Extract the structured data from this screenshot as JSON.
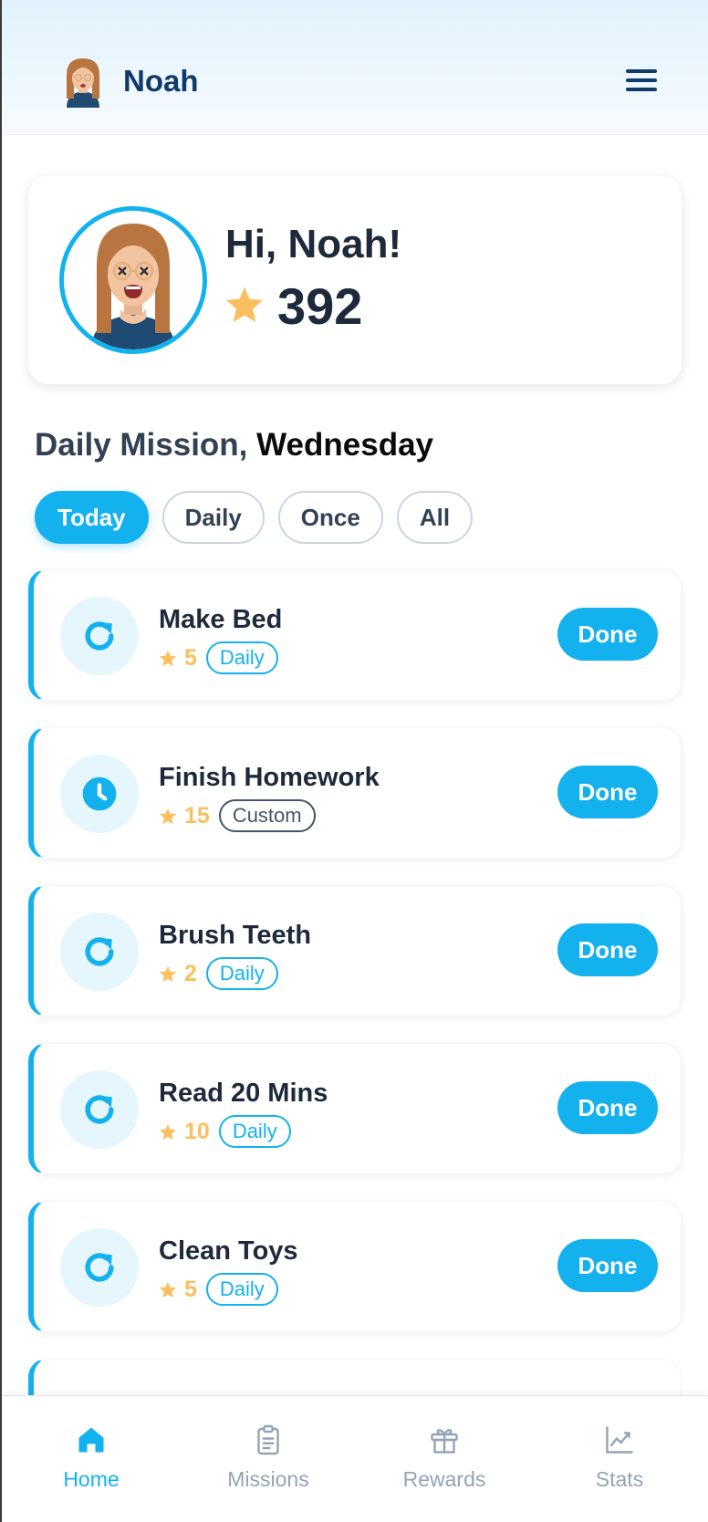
{
  "header": {
    "user_name": "Noah"
  },
  "profile": {
    "greeting": "Hi, Noah!",
    "points": "392"
  },
  "section": {
    "title_prefix": "Daily Mission,",
    "title_day": "Wednesday"
  },
  "filters": [
    {
      "label": "Today",
      "active": true
    },
    {
      "label": "Daily",
      "active": false
    },
    {
      "label": "Once",
      "active": false
    },
    {
      "label": "All",
      "active": false
    }
  ],
  "tasks": [
    {
      "title": "Make Bed",
      "points": "5",
      "tag": "Daily",
      "icon": "repeat-icon",
      "action": "Done"
    },
    {
      "title": "Finish Homework",
      "points": "15",
      "tag": "Custom",
      "icon": "clock-icon",
      "action": "Done"
    },
    {
      "title": "Brush Teeth",
      "points": "2",
      "tag": "Daily",
      "icon": "repeat-icon",
      "action": "Done"
    },
    {
      "title": "Read 20 Mins",
      "points": "10",
      "tag": "Daily",
      "icon": "repeat-icon",
      "action": "Done"
    },
    {
      "title": "Clean Toys",
      "points": "5",
      "tag": "Daily",
      "icon": "repeat-icon",
      "action": "Done"
    }
  ],
  "nav": [
    {
      "label": "Home",
      "icon": "home-icon",
      "active": true
    },
    {
      "label": "Missions",
      "icon": "clipboard-icon",
      "active": false
    },
    {
      "label": "Rewards",
      "icon": "gift-icon",
      "active": false
    },
    {
      "label": "Stats",
      "icon": "chart-line-icon",
      "active": false
    }
  ],
  "colors": {
    "accent": "#14b1ef",
    "star": "#fbbf5f",
    "heading": "#0f3a6b"
  }
}
